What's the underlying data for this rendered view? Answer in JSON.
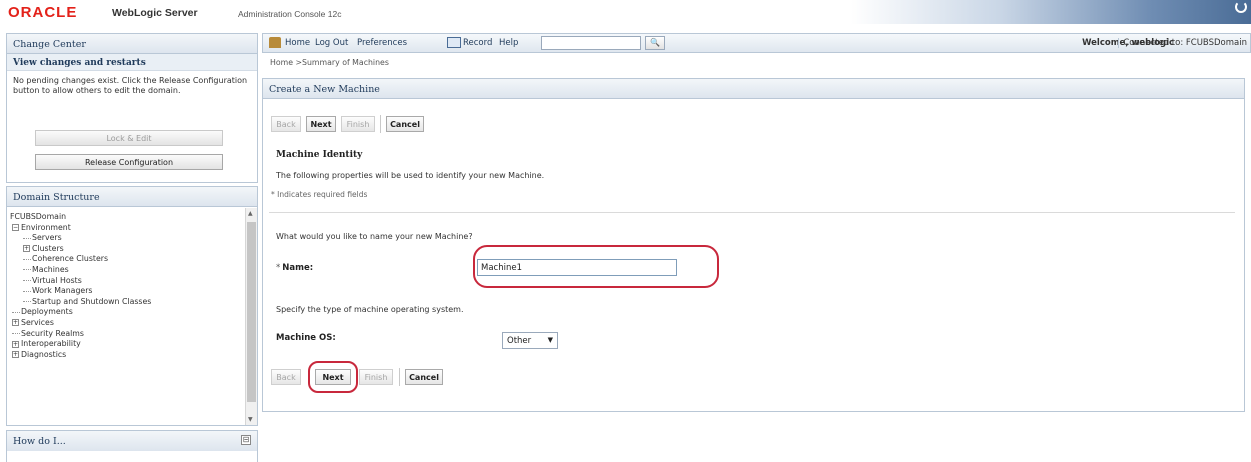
{
  "header": {
    "brand": "ORACLE",
    "product": "WebLogic Server",
    "product_sub": "Administration Console 12c"
  },
  "change_center": {
    "title": "Change Center",
    "view_changes": "View changes and restarts",
    "pending_text": "No pending changes exist. Click the Release Configuration button to allow others to edit the domain.",
    "lock_edit": "Lock & Edit",
    "release_config": "Release Configuration"
  },
  "domain_structure": {
    "title": "Domain Structure",
    "root": "FCUBSDomain",
    "items": [
      {
        "label": "Environment",
        "expander": "−"
      },
      {
        "label": "Servers"
      },
      {
        "label": "Clusters",
        "expander": "+"
      },
      {
        "label": "Coherence Clusters"
      },
      {
        "label": "Machines"
      },
      {
        "label": "Virtual Hosts"
      },
      {
        "label": "Work Managers"
      },
      {
        "label": "Startup and Shutdown Classes"
      },
      {
        "label": "Deployments"
      },
      {
        "label": "Services",
        "expander": "+"
      },
      {
        "label": "Security Realms"
      },
      {
        "label": "Interoperability",
        "expander": "+"
      },
      {
        "label": "Diagnostics",
        "expander": "+"
      }
    ]
  },
  "how_do_i": {
    "title": "How do I...",
    "collapse": "⊟"
  },
  "toolbar": {
    "home": "Home",
    "logout": "Log Out",
    "preferences": "Preferences",
    "record": "Record",
    "help": "Help",
    "search_value": "",
    "search_glyph": "🔍",
    "welcome": "Welcome, weblogic",
    "connected": "Connected to: FCUBSDomain"
  },
  "breadcrumb": "Home >Summary of Machines",
  "wizard": {
    "title": "Create a New Machine",
    "buttons": {
      "back": "Back",
      "next": "Next",
      "finish": "Finish",
      "cancel": "Cancel"
    },
    "section_title": "Machine Identity",
    "section_desc": "The following properties will be used to identify your new Machine.",
    "required_note": "* Indicates required fields",
    "name_question": "What would you like to name your new Machine?",
    "name_label": "Name:",
    "name_required": "*",
    "name_value": "Machine1",
    "os_question": "Specify the type of machine operating system.",
    "os_label": "Machine OS:",
    "os_value": "Other"
  },
  "colors": {
    "brand_red": "#e32119",
    "highlight_red": "#c8283c",
    "panel_border": "#b9c7d6",
    "title_blue": "#1f3a5a"
  }
}
